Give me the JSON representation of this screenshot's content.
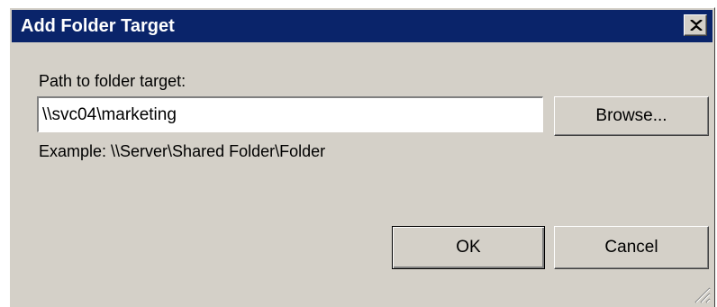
{
  "dialog": {
    "title": "Add Folder Target",
    "close_icon": "close-icon"
  },
  "form": {
    "path_label": "Path to folder target:",
    "path_value": "\\\\svc04\\marketing",
    "browse_label": "Browse...",
    "example_text": "Example: \\\\Server\\Shared Folder\\Folder"
  },
  "actions": {
    "ok_label": "OK",
    "cancel_label": "Cancel"
  },
  "colors": {
    "titlebar": "#0a246a",
    "dialog_bg": "#d4d0c8"
  }
}
